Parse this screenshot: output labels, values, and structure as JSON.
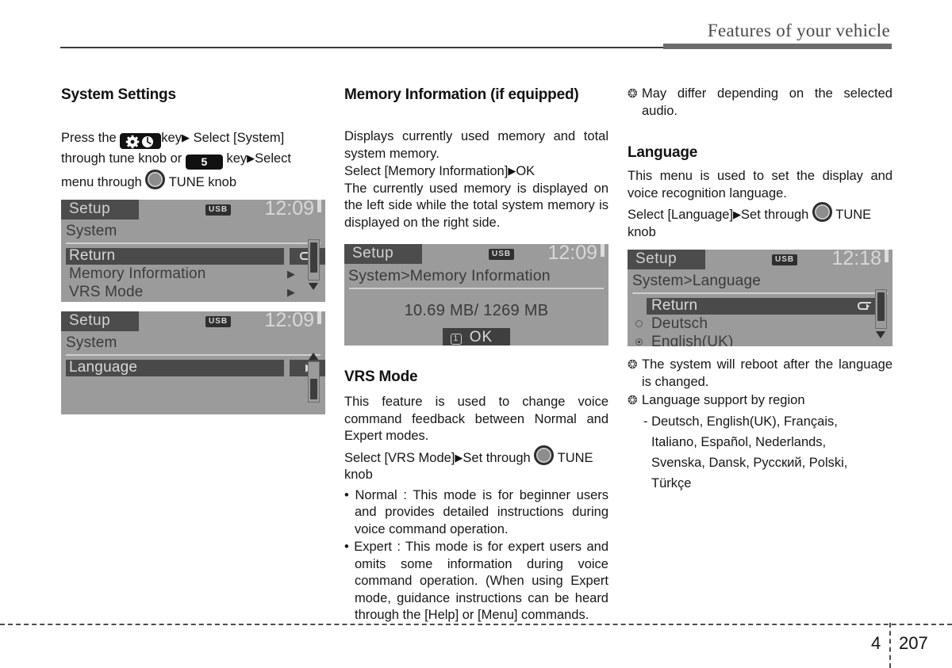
{
  "header": {
    "title": "Features of your vehicle"
  },
  "footer": {
    "chapter": "4",
    "page": "207"
  },
  "col1": {
    "heading": "System Settings",
    "press_the": "Press   the",
    "key_label_1": "key",
    "select_system": "Select  [System]",
    "through_tune_or": "through  tune  knob  or",
    "key_num": "5",
    "key_label_2": "key",
    "select2": "Select",
    "menu_through": "menu through",
    "tune_knob": "TUNE knob",
    "lcd1": {
      "tab": "Setup",
      "usb": "USB",
      "clock": "12:09",
      "path": "System",
      "rows": [
        {
          "label": "Return",
          "selected": true,
          "icon": "return-arrow"
        },
        {
          "label": "Memory Information",
          "selected": false,
          "icon": "chevron-right"
        },
        {
          "label": "VRS Mode",
          "selected": false,
          "icon": "chevron-right"
        }
      ]
    },
    "lcd2": {
      "tab": "Setup",
      "usb": "USB",
      "clock": "12:09",
      "path": "System",
      "rows": [
        {
          "label": "Language",
          "selected": true,
          "icon": "chevron-right"
        }
      ]
    }
  },
  "col2": {
    "heading1": "Memory Information (if equipped)",
    "para1": "Displays currently used memory and total system memory.",
    "select_line_pre": "Select [Memory Information]",
    "select_line_post": "OK",
    "para2": "The currently used memory is displayed on the left side while the total system memory is displayed on the right side.",
    "lcd3": {
      "tab": "Setup",
      "usb": "USB",
      "clock": "12:09",
      "path": "System>Memory Information",
      "value": "10.69 MB/ 1269 MB",
      "ok_icon": "1",
      "ok_label": "OK"
    },
    "heading2": "VRS Mode",
    "para3": "This feature is used to change voice command feedback between Normal and Expert modes.",
    "select_pre": "Select [VRS Mode]",
    "select_mid": "Set through",
    "select_post": "TUNE knob",
    "bullets": [
      "Normal : This mode is for beginner users and provides detailed instructions during voice command operation.",
      "Expert : This mode is for expert users and omits some information during voice command operation. (When using Expert mode, guidance instructions can be heard through the [Help] or [Menu] commands."
    ]
  },
  "col3": {
    "note1": "May differ depending on the selected audio.",
    "heading": "Language",
    "para1": "This menu is used to set the display and voice recognition language.",
    "select_pre": "Select  [Language]",
    "select_mid": "Set  through",
    "select_post": "TUNE knob",
    "lcd4": {
      "tab": "Setup",
      "usb": "USB",
      "clock": "12:18",
      "path": "System>Language",
      "rows": [
        {
          "label": "Return",
          "selected": true,
          "icon": "return-arrow",
          "radio": "none"
        },
        {
          "label": "Deutsch",
          "selected": false,
          "icon": "",
          "radio": "off"
        },
        {
          "label": "English(UK)",
          "selected": false,
          "icon": "",
          "radio": "on"
        }
      ]
    },
    "note2": "The system will reboot after the language is changed.",
    "note3": "Language support by region",
    "region_lines": [
      "- Deutsch, English(UK), Français,",
      "Italiano, Español, Nederlands,",
      "Svenska, Dansk, Русский, Polski,",
      "Türkçe"
    ]
  },
  "colors": {
    "lcd_bg": "#9b9b9b",
    "lcd_dark": "#4a4a4a",
    "rule": "#6c6c6c"
  }
}
